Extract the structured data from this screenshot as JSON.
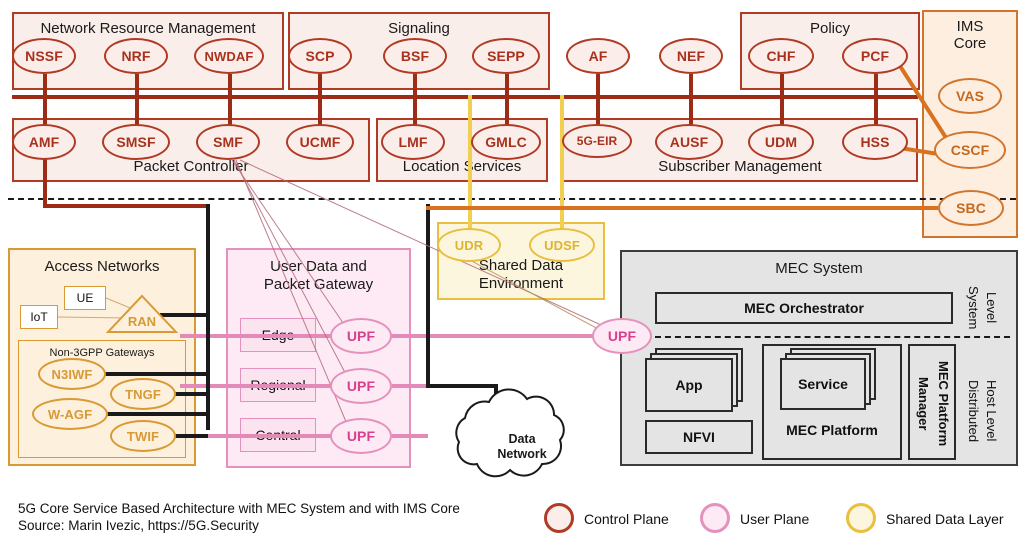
{
  "diagram": {
    "caption_line1": "5G Core Service Based Architecture with MEC System and with IMS Core",
    "caption_line2": "Source: Marin Ivezic, https://5G.Security"
  },
  "colors": {
    "control_plane": "#b03a24",
    "user_plane": "#e591bd",
    "shared_data": "#e8bf3e",
    "ims": "#d2752c",
    "access": "#d99a34",
    "mec": "#3d3d3d"
  },
  "groups": {
    "network_resource_management": {
      "title": "Network Resource Management",
      "nodes": [
        "NSSF",
        "NRF",
        "NWDAF"
      ]
    },
    "signaling": {
      "title": "Signaling",
      "nodes": [
        "SCP",
        "BSF",
        "SEPP"
      ]
    },
    "policy": {
      "title": "Policy",
      "nodes": [
        "CHF",
        "PCF"
      ]
    },
    "ims_core": {
      "title_line1": "IMS",
      "title_line2": "Core",
      "nodes": [
        "VAS",
        "CSCF",
        "SBC"
      ]
    },
    "packet_controller": {
      "title": "Packet Controller",
      "nodes": [
        "AMF",
        "SMSF",
        "SMF"
      ]
    },
    "location_services": {
      "title": "Location Services",
      "nodes": [
        "LMF",
        "GMLC"
      ]
    },
    "subscriber_management": {
      "title": "Subscriber Management",
      "nodes": [
        "5G-EIR",
        "AUSF",
        "UDM",
        "HSS"
      ]
    },
    "shared_data_environment": {
      "title_line1": "Shared Data",
      "title_line2": "Environment",
      "nodes": [
        "UDR",
        "UDSF"
      ]
    },
    "access_networks": {
      "title": "Access Networks",
      "ue": "UE",
      "iot": "IoT",
      "ran": "RAN",
      "non3gpp_title": "Non-3GPP Gateways",
      "gateways": [
        "N3IWF",
        "TNGF",
        "W-AGF",
        "TWIF"
      ]
    },
    "user_data_packet_gateway": {
      "title_line1": "User Data and",
      "title_line2": "Packet Gateway",
      "tiers": [
        "Edge",
        "Regional",
        "Central"
      ],
      "upf_label": "UPF"
    },
    "mec_system": {
      "title": "MEC System",
      "orchestrator": "MEC Orchestrator",
      "system_level_line1": "System",
      "system_level_line2": "Level",
      "distributed_line1": "Distributed",
      "distributed_line2": "Host Level",
      "app": "App",
      "service": "Service",
      "nfvi": "NFVI",
      "mec_platform": "MEC Platform",
      "platform_manager_line1": "MEC Platform",
      "platform_manager_line2": "Manager"
    }
  },
  "standalone": {
    "af": "AF",
    "nef": "NEF",
    "ucmf": "UCMF",
    "upf_edge_external": "UPF",
    "data_network_line1": "Data",
    "data_network_line2": "Network"
  },
  "legend": {
    "items": [
      {
        "label": "Control Plane",
        "color": "#b03a24",
        "fill": "#fbeeea"
      },
      {
        "label": "User Plane",
        "color": "#e591bd",
        "fill": "#fdeaf4"
      },
      {
        "label": "Shared Data Layer",
        "color": "#e8bf3e",
        "fill": "#fdf6de"
      }
    ]
  }
}
